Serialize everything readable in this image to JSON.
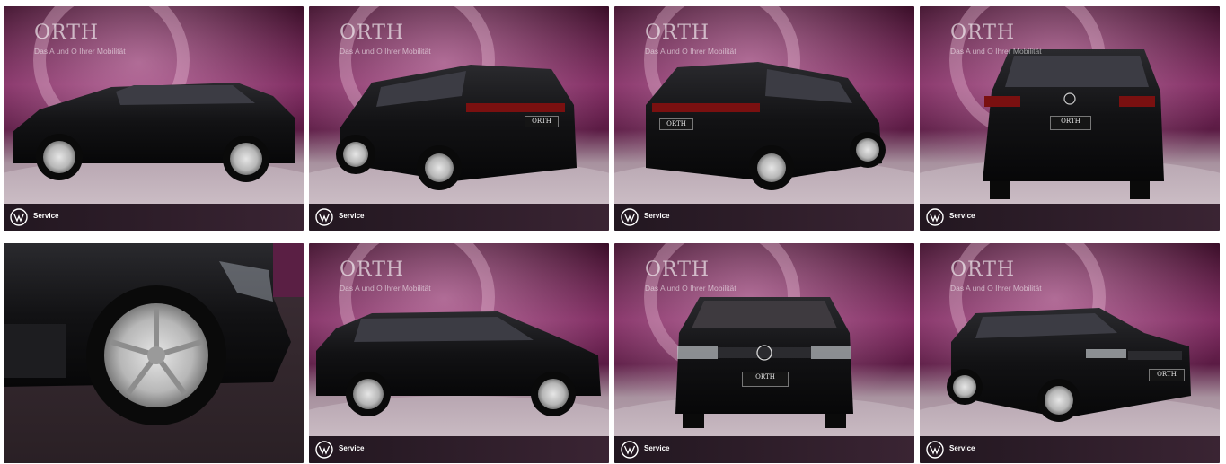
{
  "gallery": {
    "tiles": [
      {
        "view": "side-left",
        "brand": "ORTH",
        "tagline": "Das A und O Ihrer Mobilität",
        "badge": "Service",
        "plate": ""
      },
      {
        "view": "rear-three-quarter-left",
        "brand": "ORTH",
        "tagline": "Das A und O Ihrer Mobilität",
        "badge": "Service",
        "plate": "ORTH"
      },
      {
        "view": "rear-three-quarter-right",
        "brand": "ORTH",
        "tagline": "Das A und O Ihrer Mobilität",
        "badge": "Service",
        "plate": "ORTH"
      },
      {
        "view": "rear",
        "brand": "ORTH",
        "tagline": "Das A und O Ihrer Mobilität",
        "badge": "Service",
        "plate": "ORTH"
      },
      {
        "view": "wheel-detail",
        "brand": "",
        "tagline": "",
        "badge": "",
        "plate": ""
      },
      {
        "view": "side-right",
        "brand": "ORTH",
        "tagline": "Das A und O Ihrer Mobilität",
        "badge": "Service",
        "plate": ""
      },
      {
        "view": "front",
        "brand": "ORTH",
        "tagline": "Das A und O Ihrer Mobilität",
        "badge": "Service",
        "plate": "ORTH"
      },
      {
        "view": "front-three-quarter",
        "brand": "ORTH",
        "tagline": "Das A und O Ihrer Mobilität",
        "badge": "Service",
        "plate": "ORTH"
      }
    ]
  },
  "icons": {
    "brand_logo": "vw-logo-icon"
  },
  "colors": {
    "backdrop_top": "#3a0f2a",
    "backdrop_mid": "#8a2f68",
    "floor": "#b9a9b3",
    "car_body": "#141416",
    "bar": "#2a1b26"
  }
}
